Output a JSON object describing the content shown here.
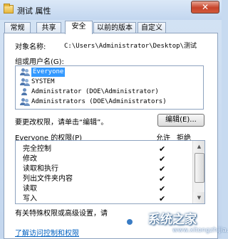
{
  "window": {
    "title": "测试 属性",
    "close_glyph": "✕"
  },
  "tabs": [
    {
      "label": "常规",
      "active": false
    },
    {
      "label": "共享",
      "active": false
    },
    {
      "label": "安全",
      "active": true
    },
    {
      "label": "以前的版本",
      "active": false
    },
    {
      "label": "自定义",
      "active": false
    }
  ],
  "object": {
    "label": "对象名称:",
    "value": "C:\\Users\\Administrator\\Desktop\\测试"
  },
  "groups": {
    "label": "组或用户名(G):",
    "items": [
      {
        "name": "Everyone",
        "icon": "users-icon",
        "selected": true
      },
      {
        "name": "SYSTEM",
        "icon": "users-icon",
        "selected": false
      },
      {
        "name": "Administrator (DOE\\Administrator)",
        "icon": "user-icon",
        "selected": false
      },
      {
        "name": "Administrators (DOE\\Administrators)",
        "icon": "users-icon",
        "selected": false
      }
    ]
  },
  "edit": {
    "hint": "要更改权限，请单击“编辑”。",
    "button_label": "编辑(E)..."
  },
  "permissions": {
    "label": "Everyone 的权限(P)",
    "allow_header": "允许",
    "deny_header": "拒绝",
    "rows": [
      {
        "name": "完全控制",
        "allow": "✔"
      },
      {
        "name": "修改",
        "allow": "✔"
      },
      {
        "name": "读取和执行",
        "allow": "✔"
      },
      {
        "name": "列出文件夹内容",
        "allow": "✔"
      },
      {
        "name": "读取",
        "allow": "✔"
      },
      {
        "name": "写入",
        "allow": "✔"
      }
    ],
    "scroll_up_glyph": "▲",
    "scroll_down_glyph": "▼"
  },
  "advanced": {
    "hint": "有关特殊权限或高级设置，请",
    "link": "了解访问控制和权限"
  },
  "watermark": {
    "text": "系统之家",
    "url": "www.xitongzhijia.net"
  },
  "colors": {
    "selection": "#3399ff",
    "link": "#0060c0",
    "close_button": "#c7432a"
  }
}
